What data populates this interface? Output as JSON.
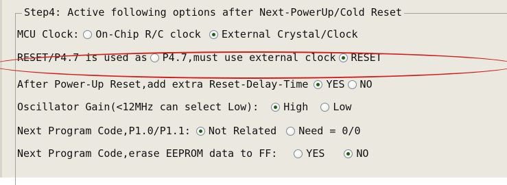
{
  "group_title": "Step4: Active following options after Next-PowerUp/Cold Reset",
  "colors": {
    "panel_bg": "#ebe9df",
    "highlight": "#d0201e",
    "radio_dot": "#1c5c1c"
  },
  "rows": [
    {
      "label": "MCU Clock:",
      "options": [
        {
          "label": "On-Chip R/C clock",
          "selected": false
        },
        {
          "label": "External Crystal/Clock",
          "selected": true
        }
      ]
    },
    {
      "label": "RESET/P4.7 is used as",
      "highlighted": true,
      "options": [
        {
          "label": "P4.7,must use external clock",
          "selected": false
        },
        {
          "label": "RESET",
          "selected": true
        }
      ]
    },
    {
      "label": "After Power-Up Reset,add extra Reset-Delay-Time",
      "options": [
        {
          "label": "YES",
          "selected": true
        },
        {
          "label": "NO",
          "selected": false
        }
      ]
    },
    {
      "label": "Oscillator Gain(<12MHz can select Low):",
      "options": [
        {
          "label": "High",
          "selected": true
        },
        {
          "label": "Low",
          "selected": false
        }
      ]
    },
    {
      "label": "Next Program Code,P1.0/P1.1:",
      "options": [
        {
          "label": "Not Related",
          "selected": true
        },
        {
          "label": "Need = 0/0",
          "selected": false
        }
      ]
    },
    {
      "label": "Next Program Code,erase EEPROM data to FF:",
      "options": [
        {
          "label": "YES",
          "selected": false
        },
        {
          "label": "NO",
          "selected": true
        }
      ]
    }
  ]
}
